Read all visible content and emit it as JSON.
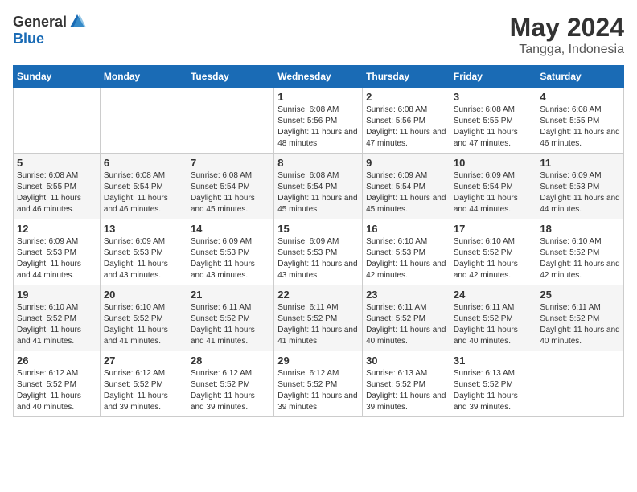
{
  "logo": {
    "general": "General",
    "blue": "Blue"
  },
  "title": {
    "month_year": "May 2024",
    "location": "Tangga, Indonesia"
  },
  "days_of_week": [
    "Sunday",
    "Monday",
    "Tuesday",
    "Wednesday",
    "Thursday",
    "Friday",
    "Saturday"
  ],
  "weeks": [
    [
      {
        "day": "",
        "info": ""
      },
      {
        "day": "",
        "info": ""
      },
      {
        "day": "",
        "info": ""
      },
      {
        "day": "1",
        "info": "Sunrise: 6:08 AM\nSunset: 5:56 PM\nDaylight: 11 hours and 48 minutes."
      },
      {
        "day": "2",
        "info": "Sunrise: 6:08 AM\nSunset: 5:56 PM\nDaylight: 11 hours and 47 minutes."
      },
      {
        "day": "3",
        "info": "Sunrise: 6:08 AM\nSunset: 5:55 PM\nDaylight: 11 hours and 47 minutes."
      },
      {
        "day": "4",
        "info": "Sunrise: 6:08 AM\nSunset: 5:55 PM\nDaylight: 11 hours and 46 minutes."
      }
    ],
    [
      {
        "day": "5",
        "info": "Sunrise: 6:08 AM\nSunset: 5:55 PM\nDaylight: 11 hours and 46 minutes."
      },
      {
        "day": "6",
        "info": "Sunrise: 6:08 AM\nSunset: 5:54 PM\nDaylight: 11 hours and 46 minutes."
      },
      {
        "day": "7",
        "info": "Sunrise: 6:08 AM\nSunset: 5:54 PM\nDaylight: 11 hours and 45 minutes."
      },
      {
        "day": "8",
        "info": "Sunrise: 6:08 AM\nSunset: 5:54 PM\nDaylight: 11 hours and 45 minutes."
      },
      {
        "day": "9",
        "info": "Sunrise: 6:09 AM\nSunset: 5:54 PM\nDaylight: 11 hours and 45 minutes."
      },
      {
        "day": "10",
        "info": "Sunrise: 6:09 AM\nSunset: 5:54 PM\nDaylight: 11 hours and 44 minutes."
      },
      {
        "day": "11",
        "info": "Sunrise: 6:09 AM\nSunset: 5:53 PM\nDaylight: 11 hours and 44 minutes."
      }
    ],
    [
      {
        "day": "12",
        "info": "Sunrise: 6:09 AM\nSunset: 5:53 PM\nDaylight: 11 hours and 44 minutes."
      },
      {
        "day": "13",
        "info": "Sunrise: 6:09 AM\nSunset: 5:53 PM\nDaylight: 11 hours and 43 minutes."
      },
      {
        "day": "14",
        "info": "Sunrise: 6:09 AM\nSunset: 5:53 PM\nDaylight: 11 hours and 43 minutes."
      },
      {
        "day": "15",
        "info": "Sunrise: 6:09 AM\nSunset: 5:53 PM\nDaylight: 11 hours and 43 minutes."
      },
      {
        "day": "16",
        "info": "Sunrise: 6:10 AM\nSunset: 5:53 PM\nDaylight: 11 hours and 42 minutes."
      },
      {
        "day": "17",
        "info": "Sunrise: 6:10 AM\nSunset: 5:52 PM\nDaylight: 11 hours and 42 minutes."
      },
      {
        "day": "18",
        "info": "Sunrise: 6:10 AM\nSunset: 5:52 PM\nDaylight: 11 hours and 42 minutes."
      }
    ],
    [
      {
        "day": "19",
        "info": "Sunrise: 6:10 AM\nSunset: 5:52 PM\nDaylight: 11 hours and 41 minutes."
      },
      {
        "day": "20",
        "info": "Sunrise: 6:10 AM\nSunset: 5:52 PM\nDaylight: 11 hours and 41 minutes."
      },
      {
        "day": "21",
        "info": "Sunrise: 6:11 AM\nSunset: 5:52 PM\nDaylight: 11 hours and 41 minutes."
      },
      {
        "day": "22",
        "info": "Sunrise: 6:11 AM\nSunset: 5:52 PM\nDaylight: 11 hours and 41 minutes."
      },
      {
        "day": "23",
        "info": "Sunrise: 6:11 AM\nSunset: 5:52 PM\nDaylight: 11 hours and 40 minutes."
      },
      {
        "day": "24",
        "info": "Sunrise: 6:11 AM\nSunset: 5:52 PM\nDaylight: 11 hours and 40 minutes."
      },
      {
        "day": "25",
        "info": "Sunrise: 6:11 AM\nSunset: 5:52 PM\nDaylight: 11 hours and 40 minutes."
      }
    ],
    [
      {
        "day": "26",
        "info": "Sunrise: 6:12 AM\nSunset: 5:52 PM\nDaylight: 11 hours and 40 minutes."
      },
      {
        "day": "27",
        "info": "Sunrise: 6:12 AM\nSunset: 5:52 PM\nDaylight: 11 hours and 39 minutes."
      },
      {
        "day": "28",
        "info": "Sunrise: 6:12 AM\nSunset: 5:52 PM\nDaylight: 11 hours and 39 minutes."
      },
      {
        "day": "29",
        "info": "Sunrise: 6:12 AM\nSunset: 5:52 PM\nDaylight: 11 hours and 39 minutes."
      },
      {
        "day": "30",
        "info": "Sunrise: 6:13 AM\nSunset: 5:52 PM\nDaylight: 11 hours and 39 minutes."
      },
      {
        "day": "31",
        "info": "Sunrise: 6:13 AM\nSunset: 5:52 PM\nDaylight: 11 hours and 39 minutes."
      },
      {
        "day": "",
        "info": ""
      }
    ]
  ]
}
